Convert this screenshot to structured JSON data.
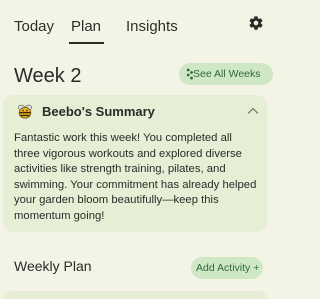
{
  "tabs": [
    {
      "label": "Today"
    },
    {
      "label": "Plan"
    },
    {
      "label": "Insights"
    }
  ],
  "active_tab": "Plan",
  "header": {
    "settings_icon": "gear-icon"
  },
  "week": {
    "title": "Week 2",
    "see_all_label": "See All Weeks",
    "see_all_icon": "dots-icon"
  },
  "summary": {
    "icon": "bee-icon",
    "title": "Beebo's Summary",
    "collapse_icon": "chevron-up-icon",
    "body": "Fantastic work this week! You completed all three vigorous workouts and explored diverse activities like strength training, pilates, and swimming. Your commitment has already helped your garden bloom beautifully—keep this momentum going!"
  },
  "weekly_plan": {
    "title": "Weekly Plan",
    "add_label": "Add Activity +"
  },
  "colors": {
    "background": "#f3f4e6",
    "card": "#e6efd6",
    "pill_bg": "#cfe7c4",
    "pill_text": "#2e6b3d"
  }
}
